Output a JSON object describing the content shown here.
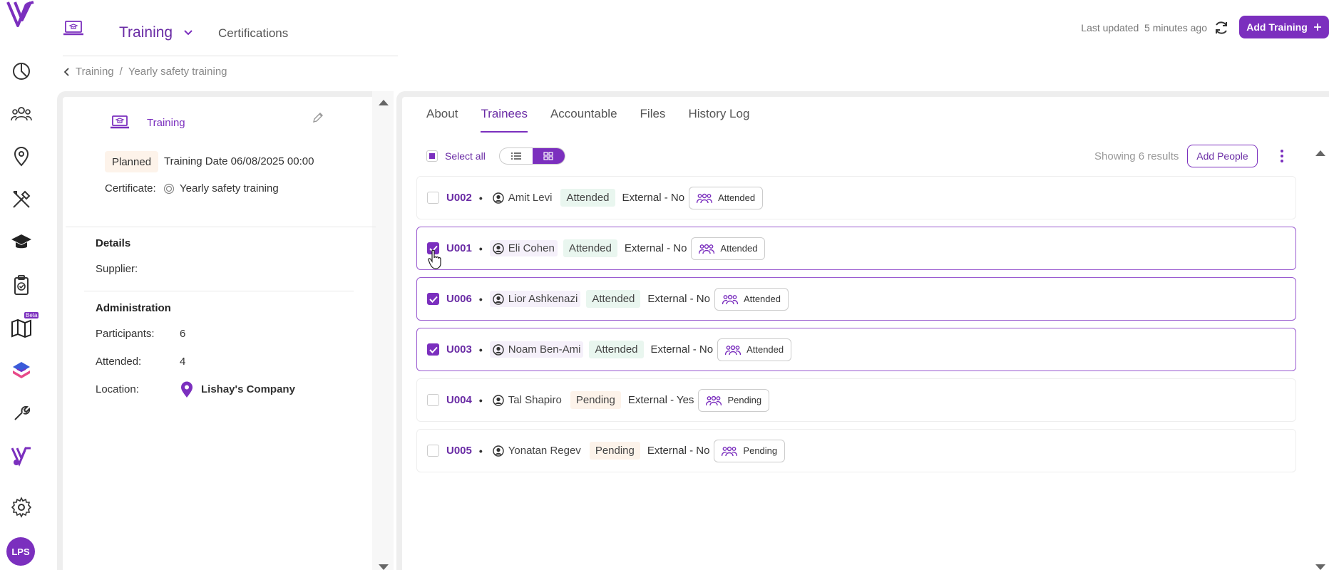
{
  "topbar": {
    "title": "Training",
    "certifications": "Certifications",
    "last_updated_label": "Last updated",
    "last_updated_value": "5 minutes ago",
    "add_button": "Add Training"
  },
  "breadcrumb": {
    "parent": "Training",
    "separator": "/",
    "current": "Yearly safety training"
  },
  "rail": {
    "beta": "Beta",
    "avatar": "LPS"
  },
  "left": {
    "type_label": "Training",
    "status": "Planned",
    "date_text": "Training Date 06/08/2025 00:00",
    "certificate_label": "Certificate:",
    "certificate_value": "Yearly safety training",
    "details_heading": "Details",
    "supplier_label": "Supplier:",
    "admin_heading": "Administration",
    "participants_label": "Participants:",
    "participants_value": "6",
    "attended_label": "Attended:",
    "attended_value": "4",
    "location_label": "Location:",
    "location_value": "Lishay's Company"
  },
  "tabs": [
    "About",
    "Trainees",
    "Accountable",
    "Files",
    "History Log"
  ],
  "active_tab": "Trainees",
  "toolbar": {
    "select_all": "Select all",
    "showing": "Showing 6 results",
    "add_people": "Add People"
  },
  "rows": [
    {
      "id": "U002",
      "name": "Amit Levi",
      "status": "Attended",
      "external": "External - No",
      "chip": "Attended",
      "checked": false
    },
    {
      "id": "U001",
      "name": "Eli Cohen",
      "status": "Attended",
      "external": "External - No",
      "chip": "Attended",
      "checked": true
    },
    {
      "id": "U006",
      "name": "Lior Ashkenazi",
      "status": "Attended",
      "external": "External - No",
      "chip": "Attended",
      "checked": true
    },
    {
      "id": "U003",
      "name": "Noam Ben-Ami",
      "status": "Attended",
      "external": "External - No",
      "chip": "Attended",
      "checked": true
    },
    {
      "id": "U004",
      "name": "Tal Shapiro",
      "status": "Pending",
      "external": "External - Yes",
      "chip": "Pending",
      "checked": false
    },
    {
      "id": "U005",
      "name": "Yonatan Regev",
      "status": "Pending",
      "external": "External - No",
      "chip": "Pending",
      "checked": false
    }
  ],
  "colors": {
    "accent": "#7b2fbe",
    "attended_bg": "#e9f6ef",
    "pending_bg": "#fdf3ea"
  }
}
